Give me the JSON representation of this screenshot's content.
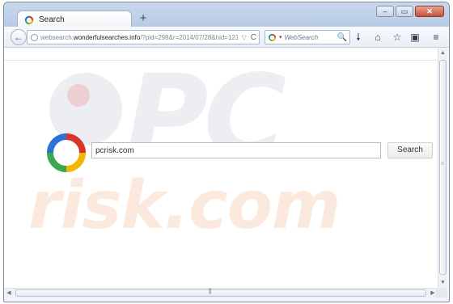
{
  "window": {
    "tab": {
      "title": "Search",
      "favicon": "colored-ring-icon"
    },
    "new_tab_label": "+",
    "controls": {
      "minimize": "–",
      "maximize": "▭",
      "close": "✕"
    }
  },
  "navbar": {
    "back_label": "←",
    "url": {
      "prefix": "websearch.",
      "domain": "wonderfulsearches.info",
      "path": "/?pid=298&r=2014/07/28&hid=121"
    },
    "url_dropdown": "▽",
    "reload": "C",
    "search_placeholder": "WebSearch",
    "search_caret": "▾",
    "search_icon": "🔍",
    "icons": {
      "download": "🠗",
      "home": "⌂",
      "bookmark": "☆",
      "clipboard": "▣",
      "menu": "≡"
    }
  },
  "page": {
    "search_value": "pcrisk.com",
    "search_button": "Search",
    "watermark": {
      "pc": "PC",
      "risk": "risk.com"
    }
  },
  "scrollbars": {
    "up": "▲",
    "down": "▼",
    "left": "◀",
    "right": "▶",
    "v_grip": "≡",
    "h_grip": "|||"
  },
  "colors": {
    "ring_blue": "#2b73d6",
    "ring_red": "#d9342b",
    "ring_yellow": "#f2b705",
    "ring_green": "#3aa84c"
  }
}
